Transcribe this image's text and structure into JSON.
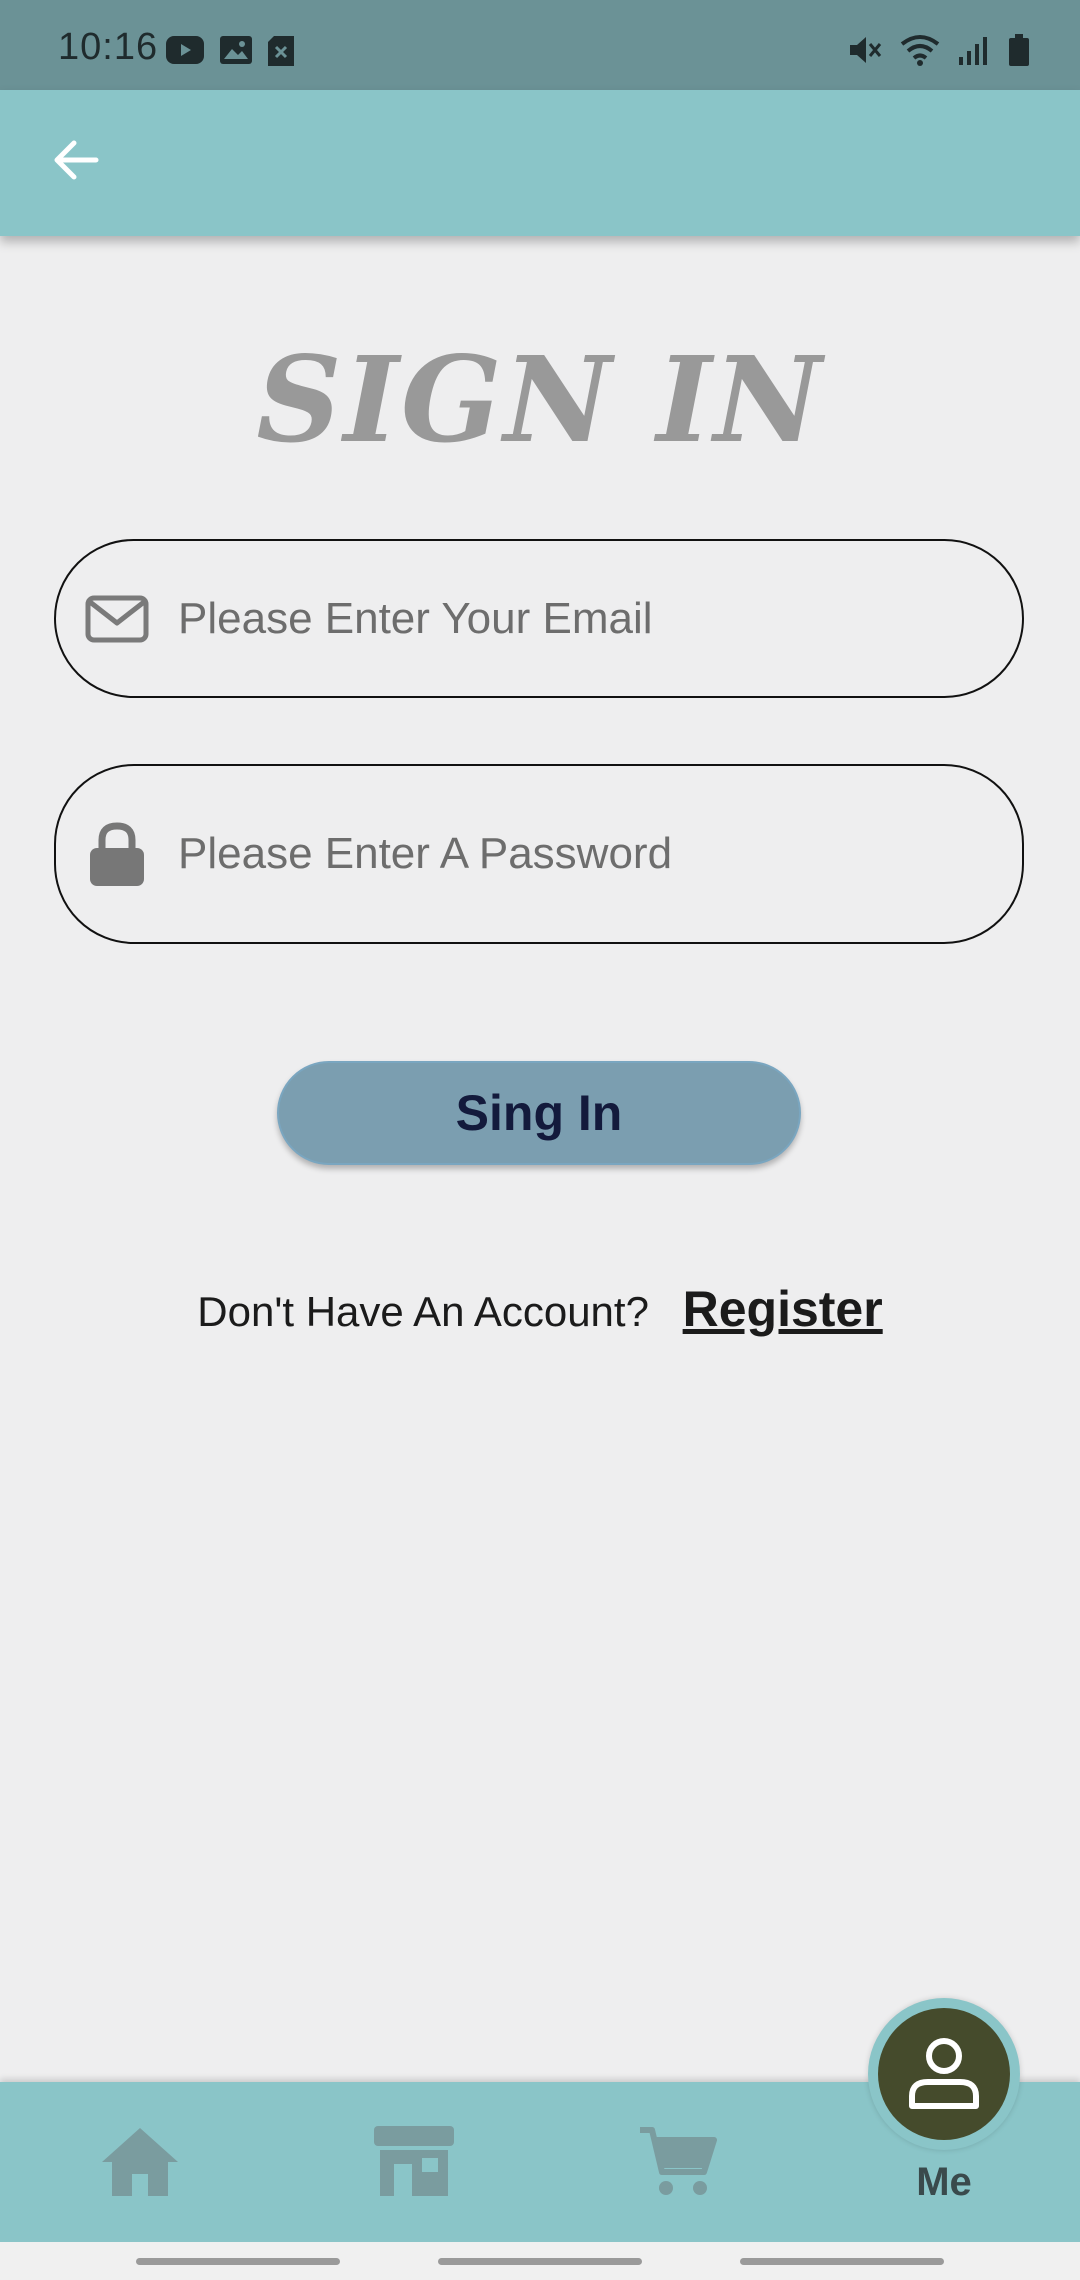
{
  "status_bar": {
    "time": "10:16",
    "left_icons": [
      "youtube-icon",
      "gallery-icon",
      "sim-error-icon"
    ],
    "right_icons": [
      "mute-icon",
      "wifi-icon",
      "signal-icon",
      "battery-icon"
    ]
  },
  "app_bar": {
    "back_icon": "arrow-left-icon"
  },
  "page": {
    "title": "SIGN IN"
  },
  "form": {
    "email_placeholder": "Please Enter Your Email",
    "password_placeholder": "Please Enter A Password",
    "submit_label": "Sing In"
  },
  "register": {
    "prompt": "Don't Have An Account?",
    "link_label": "Register"
  },
  "bottom_nav": {
    "items": [
      {
        "icon": "home-icon"
      },
      {
        "icon": "store-icon"
      },
      {
        "icon": "cart-icon"
      },
      {
        "icon": "person-icon",
        "label": "Me"
      }
    ]
  },
  "colors": {
    "app_bar": "#8ac5c8",
    "status_bar": "#6b9296",
    "button": "#7b9eb0",
    "fab": "#454b2c",
    "background": "#eeeeef"
  }
}
